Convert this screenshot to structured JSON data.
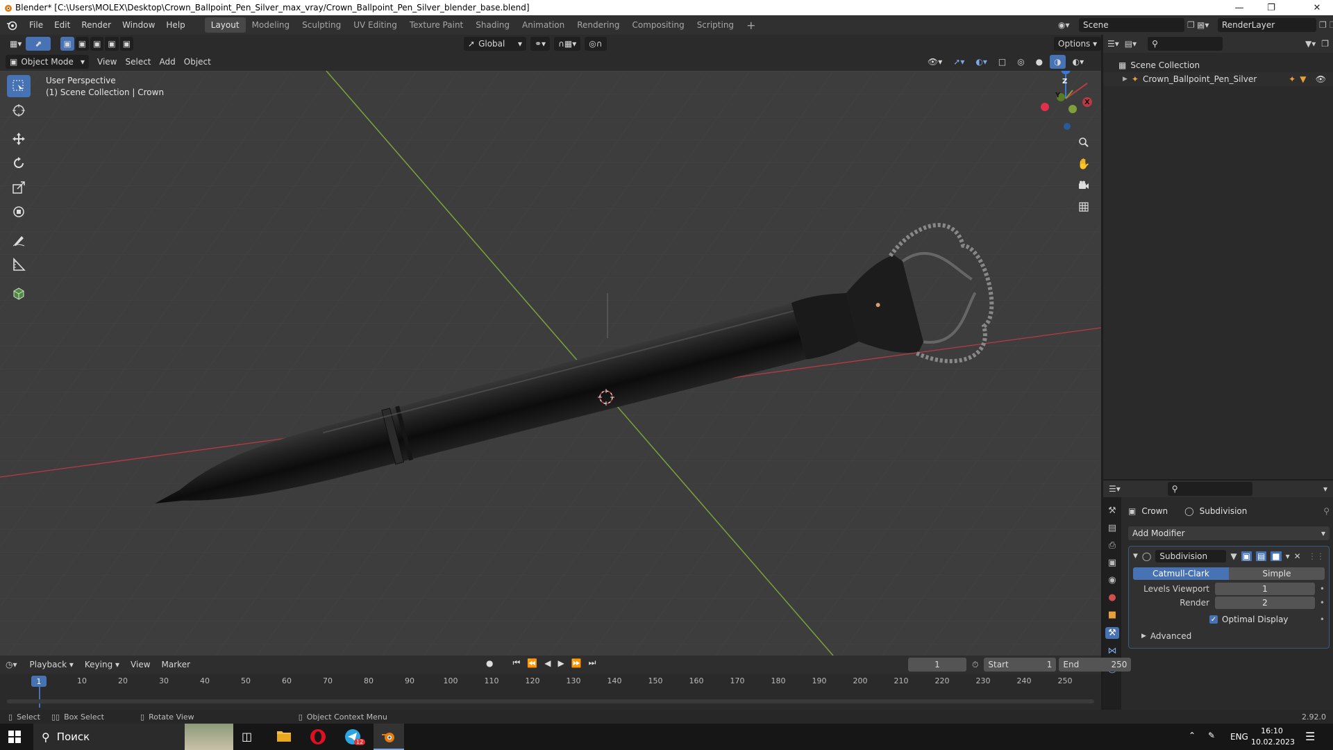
{
  "window": {
    "title": "Blender* [C:\\Users\\MOLEX\\Desktop\\Crown_Ballpoint_Pen_Silver_max_vray/Crown_Ballpoint_Pen_Silver_blender_base.blend]"
  },
  "menus": [
    "File",
    "Edit",
    "Render",
    "Window",
    "Help"
  ],
  "workspaces": [
    "Layout",
    "Modeling",
    "Sculpting",
    "UV Editing",
    "Texture Paint",
    "Shading",
    "Animation",
    "Rendering",
    "Compositing",
    "Scripting"
  ],
  "active_workspace": "Layout",
  "scene": {
    "name": "Scene",
    "render_layer": "RenderLayer"
  },
  "viewport_header": {
    "transform_orientation": "Global",
    "options_label": "Options",
    "mode": "Object Mode",
    "menus": [
      "View",
      "Select",
      "Add",
      "Object"
    ]
  },
  "viewport": {
    "perspective": "User Perspective",
    "collection_info": "(1) Scene Collection | Crown",
    "gizmo": {
      "z": "Z",
      "y": "Y",
      "x": "X"
    }
  },
  "outliner": {
    "root": "Scene Collection",
    "items": [
      {
        "label": "Crown_Ballpoint_Pen_Silver"
      }
    ]
  },
  "properties": {
    "object_name": "Crown",
    "modifier_breadcrumb": "Subdivision",
    "add_modifier": "Add Modifier",
    "modifier": {
      "name": "Subdivision",
      "algorithm_options": [
        "Catmull-Clark",
        "Simple"
      ],
      "selected_algorithm": "Catmull-Clark",
      "levels_viewport_label": "Levels Viewport",
      "levels_viewport": "1",
      "render_label": "Render",
      "render": "2",
      "optimal_display_label": "Optimal Display",
      "optimal_display": true,
      "advanced_label": "Advanced"
    }
  },
  "timeline": {
    "menus": [
      "Playback",
      "Keying",
      "View",
      "Marker"
    ],
    "current_frame": "1",
    "start_label": "Start",
    "start": "1",
    "end_label": "End",
    "end": "250",
    "ruler_marks": [
      "10",
      "20",
      "30",
      "40",
      "50",
      "60",
      "70",
      "80",
      "90",
      "100",
      "110",
      "120",
      "130",
      "140",
      "150",
      "160",
      "170",
      "180",
      "190",
      "200",
      "210",
      "220",
      "230",
      "240",
      "250"
    ],
    "playhead": "1"
  },
  "statusbar": {
    "select": "Select",
    "box_select": "Box Select",
    "rotate_view": "Rotate View",
    "context_menu": "Object Context Menu",
    "version": "2.92.0"
  },
  "taskbar": {
    "search_placeholder": "Поиск",
    "language": "ENG",
    "time": "16:10",
    "date": "10.02.2023",
    "telegram_badge": "12"
  },
  "colors": {
    "accent": "#4772b3",
    "x_axis": "#b93a45",
    "y_axis": "#7ea03a",
    "z_axis": "#3a7ad8",
    "viewport_bg": "#3d3d3d"
  }
}
